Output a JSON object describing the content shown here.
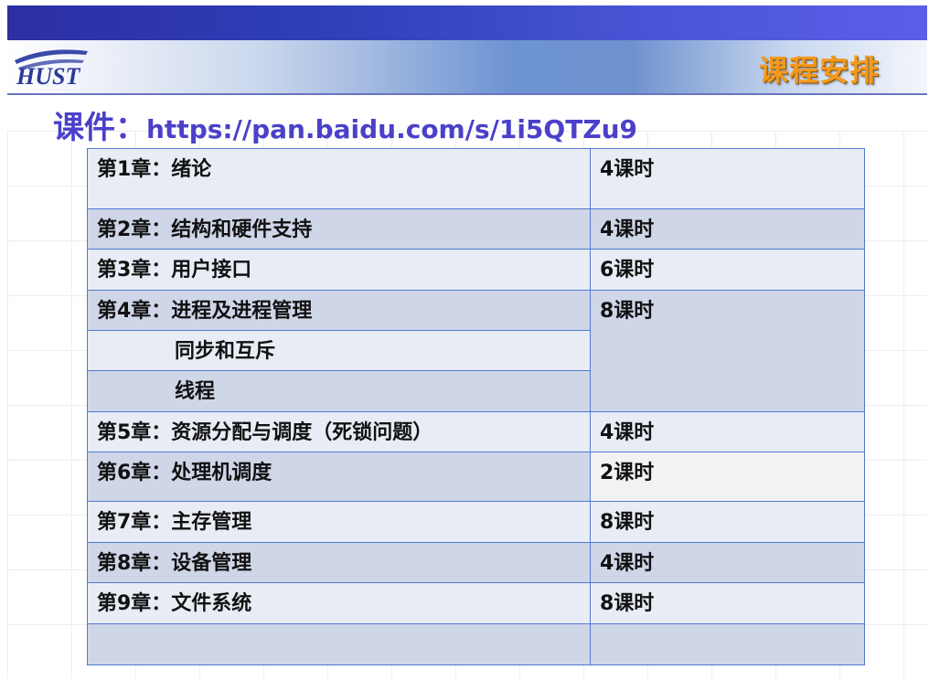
{
  "header": {
    "section_title": "课程安排",
    "logo_text": "HUST"
  },
  "courseware": {
    "label": "课件：",
    "url": "https://pan.baidu.com/s/1i5QTZu9"
  },
  "schedule": {
    "rows": [
      {
        "topic": "第1章：绪论",
        "hours": "4课时"
      },
      {
        "topic": "第2章：结构和硬件支持",
        "hours": "4课时"
      },
      {
        "topic": "第3章：用户接口",
        "hours": "6课时"
      },
      {
        "topic": "第4章：进程及进程管理",
        "hours": "8课时"
      },
      {
        "topic": "同步和互斥",
        "hours": ""
      },
      {
        "topic": "线程",
        "hours": ""
      },
      {
        "topic": "第5章：资源分配与调度（死锁问题）",
        "hours": "4课时"
      },
      {
        "topic": "第6章：处理机调度",
        "hours": "2课时"
      },
      {
        "topic": "第7章：主存管理",
        "hours": "8课时"
      },
      {
        "topic": "第8章：设备管理",
        "hours": "4课时"
      },
      {
        "topic": "第9章：文件系统",
        "hours": "8课时"
      },
      {
        "topic": "",
        "hours": ""
      }
    ]
  }
}
